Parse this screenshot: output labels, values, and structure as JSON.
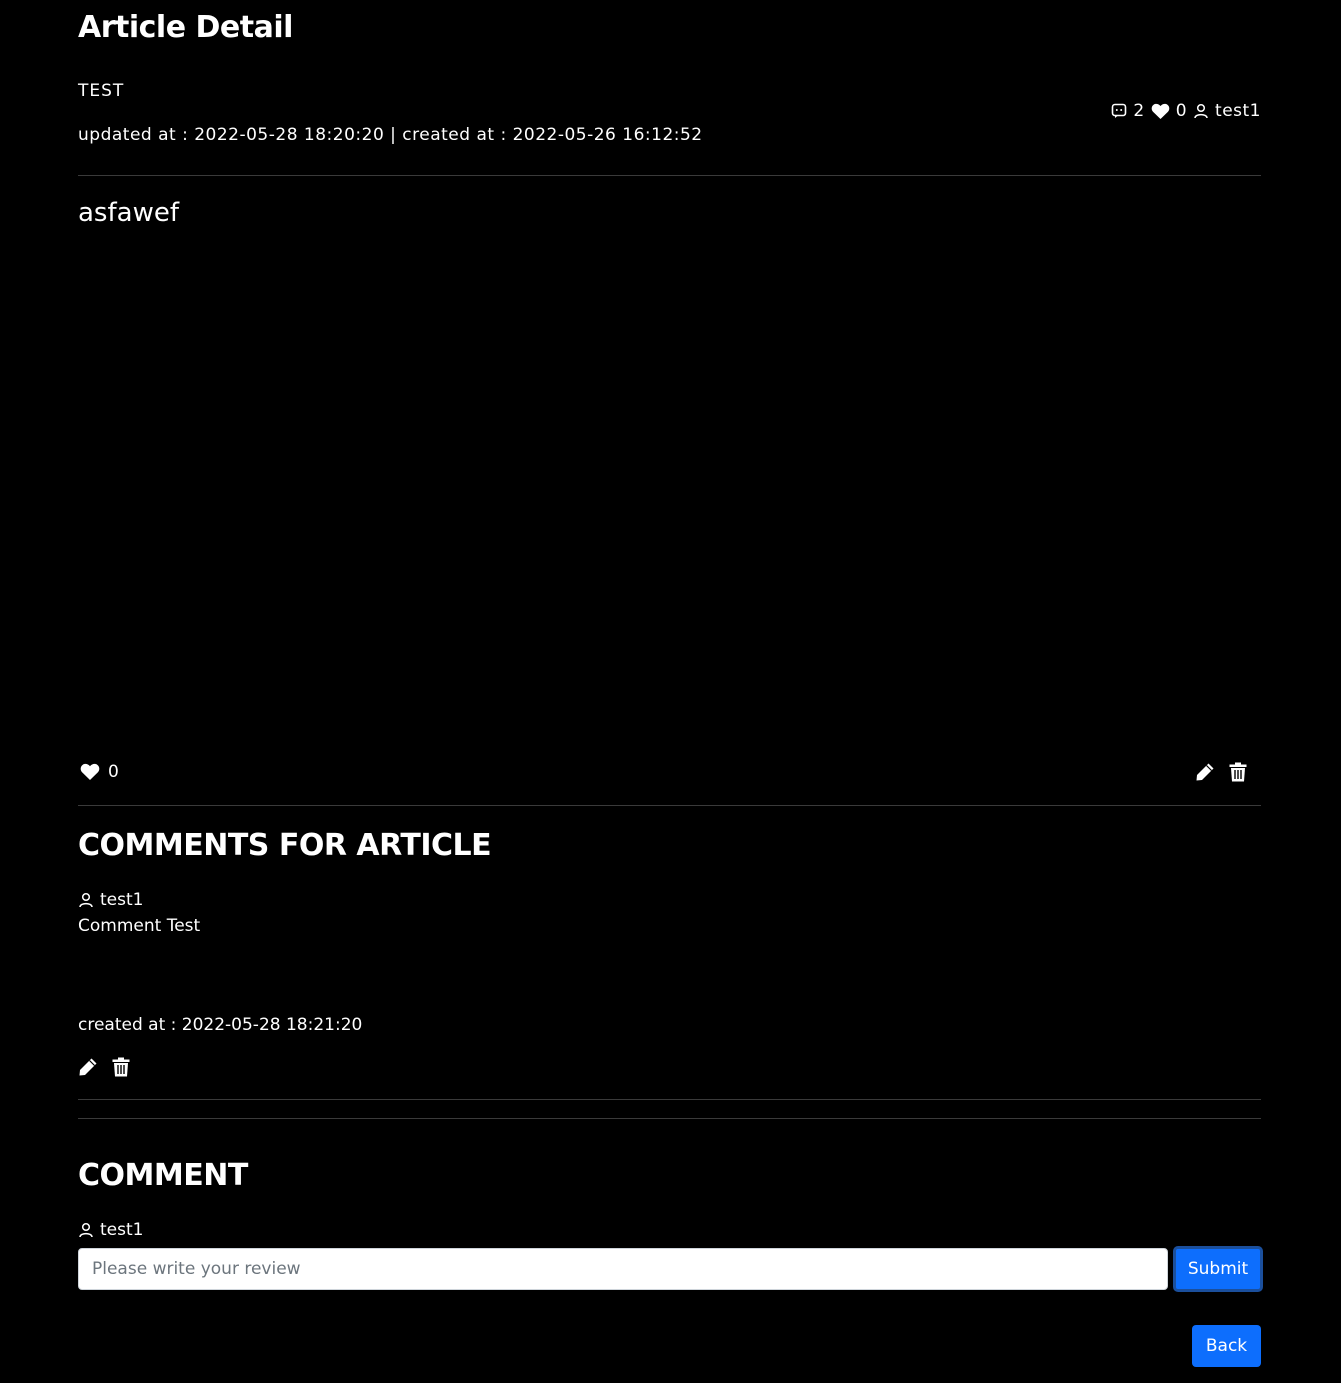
{
  "page": {
    "title": "Article Detail"
  },
  "article": {
    "title": "TEST",
    "dates": "updated at : 2022-05-28 18:20:20 | created at : 2022-05-26 16:12:52",
    "comment_count": "2",
    "like_count": "0",
    "author": "test1",
    "body": "asfawef",
    "footer_like_count": "0"
  },
  "comments_section": {
    "heading": "COMMENTS FOR ARTICLE",
    "items": [
      {
        "author": "test1",
        "text": "Comment Test",
        "created": "created at : 2022-05-28 18:21:20"
      }
    ]
  },
  "comment_form": {
    "heading": "COMMENT",
    "author": "test1",
    "placeholder": "Please write your review",
    "submit_label": "Submit"
  },
  "navigation": {
    "back_label": "Back"
  },
  "colors": {
    "background": "#000000",
    "text": "#ffffff",
    "primary": "#0d6efd",
    "divider": "#3a3a3a"
  },
  "icons": {
    "comment": "comment-icon",
    "heart": "heart-icon",
    "user": "user-icon",
    "edit": "pencil-icon",
    "delete": "trash-icon"
  }
}
